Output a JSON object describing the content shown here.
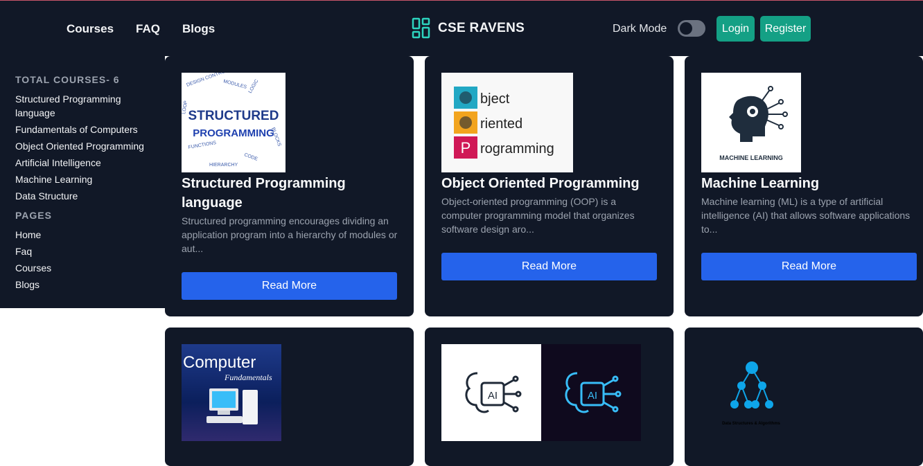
{
  "nav": {
    "links": [
      "Courses",
      "FAQ",
      "Blogs"
    ],
    "brand": "CSE RAVENS",
    "dark_mode_label": "Dark Mode",
    "login": "Login",
    "register": "Register"
  },
  "sidebar": {
    "total_heading": "TOTAL COURSES- 6",
    "courses": [
      "Structured Programming language",
      "Fundamentals of Computers",
      "Object Oriented Programming",
      "Artificial Intelligence",
      "Machine Learning",
      "Data Structure"
    ],
    "pages_heading": "PAGES",
    "pages": [
      "Home",
      "Faq",
      "Courses",
      "Blogs"
    ]
  },
  "cards": [
    {
      "title": "Structured Programming language",
      "desc": "Structured programming encourages dividing an application program into a hierarchy of modules or aut...",
      "button": "Read More",
      "img_title": "STRUCTURED",
      "img_sub": "PROGRAMMING"
    },
    {
      "title": "Object Oriented Programming",
      "desc": "Object-oriented programming (OOP) is a computer programming model that organizes software design aro...",
      "button": "Read More",
      "img_lines": [
        "bject",
        "riented",
        "rogramming"
      ],
      "img_letters": [
        "O",
        "O",
        "P"
      ]
    },
    {
      "title": "Machine Learning",
      "desc": "Machine learning (ML) is a type of artificial intelligence (AI) that allows software applications to...",
      "button": "Read More",
      "img_label": "MACHINE LEARNING"
    },
    {
      "img_title": "Computer",
      "img_sub": "Fundamentals"
    },
    {
      "img_label": "AI"
    },
    {
      "img_label": "Data Structures & Algorithms"
    }
  ],
  "colors": {
    "nav_bg": "#111827",
    "accent_teal": "#14a085",
    "button_blue": "#2563eb"
  }
}
